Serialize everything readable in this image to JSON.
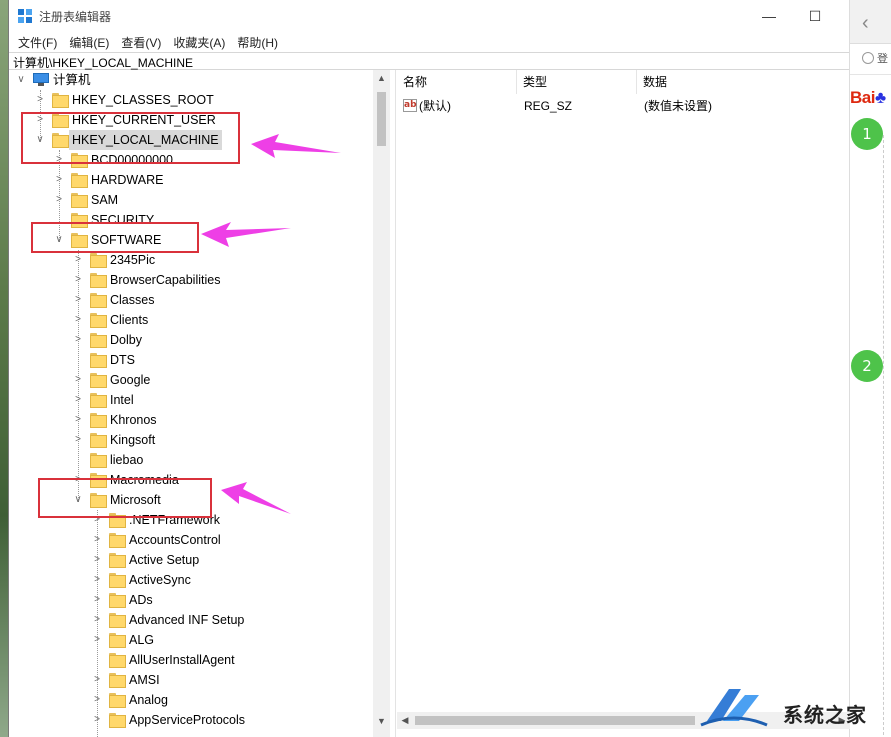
{
  "window": {
    "title": "注册表编辑器",
    "controls": {
      "minimize": "—",
      "maximize": "☐"
    }
  },
  "menu": [
    "文件(F)",
    "编辑(E)",
    "查看(V)",
    "收藏夹(A)",
    "帮助(H)"
  ],
  "address": "计算机\\HKEY_LOCAL_MACHINE",
  "tree": {
    "root": "计算机",
    "hives": [
      "HKEY_CLASSES_ROOT",
      "HKEY_CURRENT_USER",
      "HKEY_LOCAL_MACHINE"
    ],
    "hklm_children": [
      "BCD00000000",
      "HARDWARE",
      "SAM",
      "SECURITY",
      "SOFTWARE"
    ],
    "software_children": [
      "2345Pic",
      "BrowserCapabilities",
      "Classes",
      "Clients",
      "Dolby",
      "DTS",
      "Google",
      "Intel",
      "Khronos",
      "Kingsoft",
      "liebao",
      "Macromedia",
      "Microsoft"
    ],
    "microsoft_children": [
      ".NETFramework",
      "AccountsControl",
      "Active Setup",
      "ActiveSync",
      "ADs",
      "Advanced INF Setup",
      "ALG",
      "AllUserInstallAgent",
      "AMSI",
      "Analog",
      "AppServiceProtocols"
    ]
  },
  "values_pane": {
    "headers": {
      "name": "名称",
      "type": "类型",
      "data": "数据"
    },
    "rows": [
      {
        "name": "(默认)",
        "type": "REG_SZ",
        "data": "(数值未设置)"
      }
    ]
  },
  "browser": {
    "login_text": "登",
    "logo_text": "Bai",
    "steps": [
      "1",
      "2"
    ]
  },
  "watermark": {
    "text": "系统之家"
  },
  "colors": {
    "annotation_red": "#d9313b",
    "arrow_magenta": "#ee3fe6",
    "folder": "#ffd86b",
    "step_green": "#4ec34a"
  }
}
